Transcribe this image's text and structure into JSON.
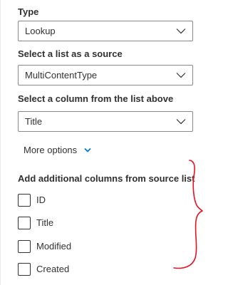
{
  "type_field": {
    "label": "Type",
    "value": "Lookup"
  },
  "source_list_field": {
    "label": "Select a list as a source",
    "value": "MultiContentType"
  },
  "column_field": {
    "label": "Select a column from the list above",
    "value": "Title"
  },
  "more_options": {
    "label": "More options",
    "chevron_icon": "chevron-down-icon",
    "accent_color": "#0078d4"
  },
  "additional_columns": {
    "label": "Add additional columns from source list",
    "options": [
      {
        "label": "ID",
        "checked": false
      },
      {
        "label": "Title",
        "checked": false
      },
      {
        "label": "Modified",
        "checked": false
      },
      {
        "label": "Created",
        "checked": false
      }
    ]
  },
  "annotation": {
    "shape": "curly-brace",
    "color": "#e81123"
  }
}
